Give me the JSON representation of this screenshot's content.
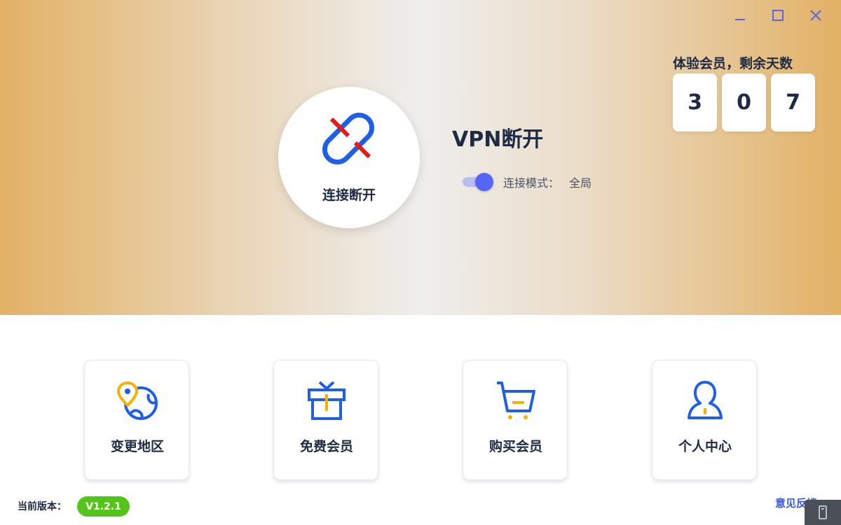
{
  "window": {
    "minimize_icon": "minimize-icon",
    "maximize_icon": "maximize-icon",
    "close_icon": "close-icon"
  },
  "trial": {
    "title": "体验会员，剩余天数",
    "digits": [
      "3",
      "0",
      "7"
    ]
  },
  "connection": {
    "button_label": "连接断开",
    "status_title": "VPN断开",
    "icon": "broken-link-icon",
    "mode_label": "连接模式：",
    "mode_value": "全局",
    "mode_toggle_on": true
  },
  "actions": [
    {
      "label": "变更地区",
      "icon": "globe-location-icon"
    },
    {
      "label": "免费会员",
      "icon": "gift-icon"
    },
    {
      "label": "购买会员",
      "icon": "shopping-cart-icon"
    },
    {
      "label": "个人中心",
      "icon": "user-icon"
    }
  ],
  "footer": {
    "version_label": "当前版本：",
    "version_value": "V1.2.1",
    "feedback_label": "意见反馈"
  },
  "colors": {
    "accent_blue": "#1f5fe6",
    "accent_orange": "#f5b301",
    "broken_red": "#e81919",
    "toggle_blue": "#5466f5",
    "version_green": "#52c41a",
    "feedback_blue": "#3a56e8",
    "hero_gold": "#e2b165"
  }
}
